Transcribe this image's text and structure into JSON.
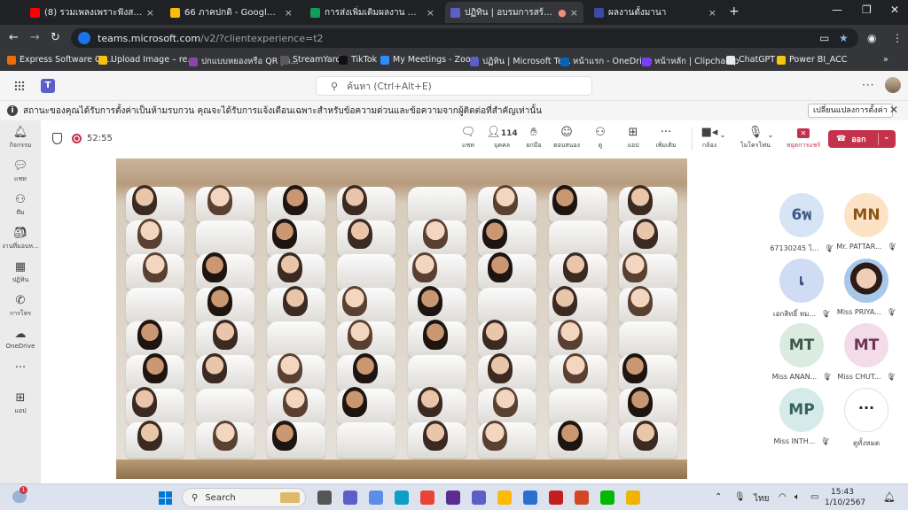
{
  "browser": {
    "tabs": [
      {
        "title": "(8) รวมเพลงเพราะฟังสบายๆในร้านกาแฟ",
        "color": "#ff0000"
      },
      {
        "title": "66 ภาคปกติ - Google ไดรฟ์",
        "color": "#fbbc04"
      },
      {
        "title": "การส่งเพิ่มเติมผลงาน Google Sites",
        "color": "#0f9d58"
      },
      {
        "title": "ปฏิทิน | อบรมการสร้าง Google Site",
        "color": "#5b5fc7"
      },
      {
        "title": "ผลงานตั้งมานา",
        "color": "#3c4aa3"
      }
    ],
    "url_host": "teams.microsoft.com",
    "url_path": "/v2/?clientexperience=t2",
    "bookmarks": [
      {
        "label": "Express Software Gr...",
        "color": "#ef6c00"
      },
      {
        "label": "Upload Image – re...",
        "color": "#f4c20d"
      },
      {
        "label": "ปกแบบหยองหรือ QR | ร...",
        "color": "#8e44ad"
      },
      {
        "label": "StreamYard",
        "color": "#3a3a3a"
      },
      {
        "label": "TikTok",
        "color": "#000000"
      },
      {
        "label": "My Meetings - Zoom",
        "color": "#2d8cff"
      },
      {
        "label": "ปฏิทิน | Microsoft Te...",
        "color": "#5b5fc7"
      },
      {
        "label": "หน้าแรก - OneDrive",
        "color": "#0364b8"
      },
      {
        "label": "หน้าหลัก | Clipchamp",
        "color": "#7a3cff"
      },
      {
        "label": "ChatGPT",
        "color": "#e8eaed"
      },
      {
        "label": "Power BI_ACC",
        "color": "#f2c811"
      }
    ]
  },
  "teams": {
    "search_placeholder": "ค้นหา (Ctrl+Alt+E)",
    "notice": "สถานะของคุณได้รับการตั้งค่าเป็นห้ามรบกวน คุณจะได้รับการแจ้งเตือนเฉพาะสำหรับข้อความด่วนและข้อความจากผู้ติดต่อที่สำคัญเท่านั้น",
    "notice_action": "เปลี่ยนแปลงการตั้งค่า",
    "rail": [
      {
        "label": "กิจกรรม",
        "icon": "bell-icon"
      },
      {
        "label": "แชท",
        "icon": "chat-icon"
      },
      {
        "label": "ทีม",
        "icon": "teams-icon"
      },
      {
        "label": "งานที่มอบห...",
        "icon": "assignments-icon"
      },
      {
        "label": "ปฏิทิน",
        "icon": "calendar-icon"
      },
      {
        "label": "การโทร",
        "icon": "phone-icon"
      },
      {
        "label": "OneDrive",
        "icon": "onedrive-icon"
      },
      {
        "label": "",
        "icon": "more-icon"
      },
      {
        "label": "แอป",
        "icon": "apps-icon"
      }
    ],
    "meeting": {
      "timer": "52:55",
      "participant_count": "114",
      "controls": [
        {
          "label": "แชท",
          "icon": "chat-icon"
        },
        {
          "label": "บุคคล",
          "icon": "people-icon"
        },
        {
          "label": "ยกมือ",
          "icon": "raise-hand-icon"
        },
        {
          "label": "ตอบสนอง",
          "icon": "react-icon"
        },
        {
          "label": "ดู",
          "icon": "view-icon"
        },
        {
          "label": "แอป",
          "icon": "add-app-icon"
        },
        {
          "label": "เพิ่มเติม",
          "icon": "more-icon"
        },
        {
          "label": "กล้อง",
          "icon": "camera-icon"
        },
        {
          "label": "ไมโครโฟน",
          "icon": "mic-icon"
        },
        {
          "label": "หยุดการแชร์",
          "icon": "stop-share-icon"
        }
      ],
      "leave_label": "ออก"
    },
    "participants": [
      {
        "initials": "6พ",
        "name": "67130245 โ...",
        "bg": "#d6e4f5",
        "fg": "#3c5a85"
      },
      {
        "initials": "MN",
        "name": "Mr. PATTAR...",
        "bg": "#fde3c6",
        "fg": "#8a5418"
      },
      {
        "initials": "เ",
        "name": "เอกสิทธิ์ ทม...",
        "bg": "#cfdcf3",
        "fg": "#2b3f7a"
      },
      {
        "initials": "",
        "name": "Miss PRIYA...",
        "bg": "#ffffff",
        "fg": "#000000"
      },
      {
        "initials": "MT",
        "name": "Miss ANAN...",
        "bg": "#dcebe0",
        "fg": "#3d5c46"
      },
      {
        "initials": "MT",
        "name": "Miss CHUT...",
        "bg": "#f3dbe8",
        "fg": "#6d3552"
      },
      {
        "initials": "MP",
        "name": "Miss INTH...",
        "bg": "#d5ebe9",
        "fg": "#34625e"
      }
    ],
    "more_label": "ดูทั้งหมด"
  },
  "taskbar": {
    "search_label": "Search",
    "notification_count": "1",
    "language": "ไทย",
    "time": "15:43",
    "date": "1/10/2567",
    "apps": [
      "#555555",
      "#5b5fc7",
      "#5c8ee6",
      "#0c9fc7",
      "#ea4335",
      "#5b2d91",
      "#5b5fc7",
      "#ffb900",
      "#2c6fd1",
      "#c41f1f",
      "#d24726",
      "#00b900",
      "#f0b400"
    ]
  }
}
